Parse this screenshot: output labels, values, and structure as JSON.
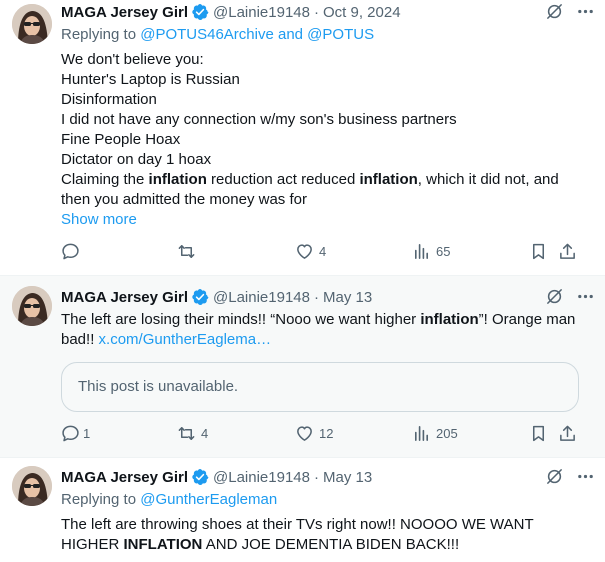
{
  "tweets": [
    {
      "author_name": "MAGA Jersey Girl",
      "handle": "@Lainie19148",
      "date": "Oct 9, 2024",
      "replying_prefix": "Replying to",
      "replying_to": "@POTUS46Archive and @POTUS",
      "lines": {
        "l1": "We don't believe you:",
        "l2": "Hunter's Laptop is Russian",
        "l3": "Disinformation",
        "l4": "I did not have any connection w/my son's business partners",
        "l5": "Fine People Hoax",
        "l6": "Dictator on day 1 hoax",
        "l7a": "Claiming the ",
        "l7b": "inflation",
        "l7c": " reduction act reduced ",
        "l7d": "inflation",
        "l7e": ", which it did not, and",
        "l8": "then you admitted the money was for"
      },
      "show_more": "Show more",
      "stats": {
        "replies": "",
        "reposts": "",
        "likes": "4",
        "views": "65"
      }
    },
    {
      "author_name": "MAGA Jersey Girl",
      "handle": "@Lainie19148",
      "date": "May 13",
      "text_a": "The left are losing their minds!!  “Nooo we want higher ",
      "text_b": "inflation",
      "text_c": "”!   Orange man bad!! ",
      "link": "x.com/GuntherEaglema…",
      "quote_text": "This post is unavailable.",
      "stats": {
        "replies": "1",
        "reposts": "4",
        "likes": "12",
        "views": "205"
      }
    },
    {
      "author_name": "MAGA Jersey Girl",
      "handle": "@Lainie19148",
      "date": "May 13",
      "replying_prefix": "Replying to",
      "replying_to": "@GuntherEagleman",
      "text_a": "The left are throwing shoes at their TVs right now!!  NOOOO WE WANT HIGHER ",
      "text_b": "INFLATION",
      "text_c": " AND JOE DEMENTIA BIDEN BACK!!!"
    }
  ],
  "colors": {
    "accent": "#1d9bf0",
    "secondary_text": "#536471",
    "verified": "#1d9bf0"
  },
  "icons": [
    "verified-badge-icon",
    "grok-icon",
    "more-icon",
    "reply-icon",
    "repost-icon",
    "like-icon",
    "views-icon",
    "bookmark-icon",
    "share-icon"
  ]
}
